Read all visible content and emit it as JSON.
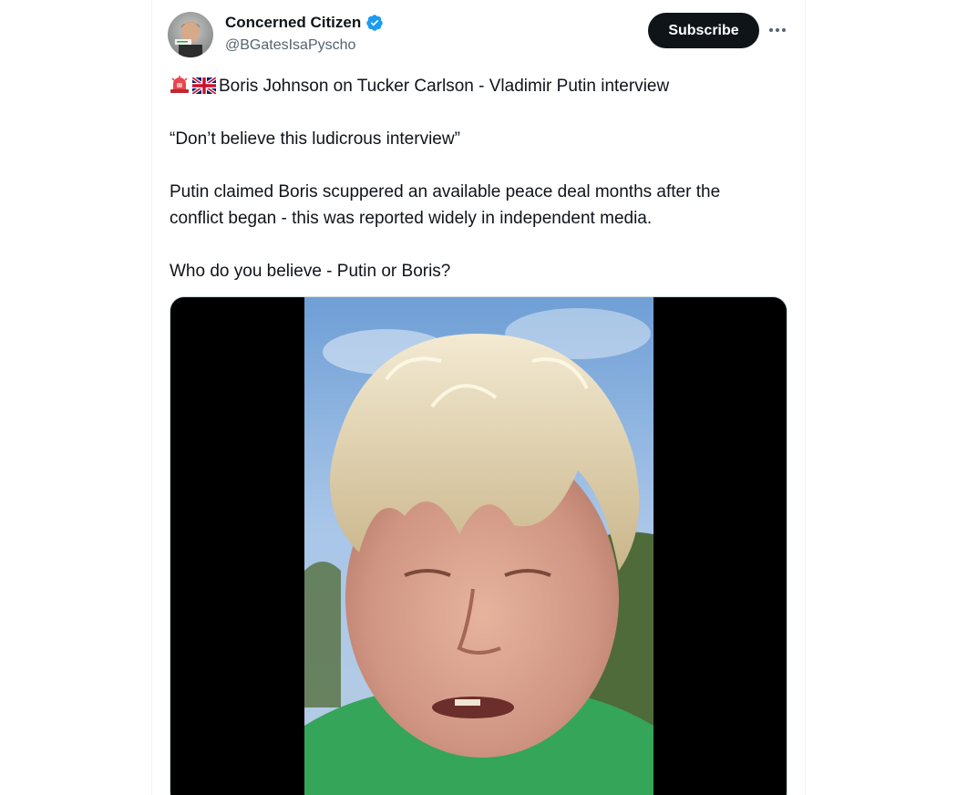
{
  "author": {
    "display_name": "Concerned Citizen",
    "handle": "@BGatesIsaPyscho",
    "verified": true,
    "avatar": "avatar-photo"
  },
  "actions": {
    "subscribe_label": "Subscribe",
    "more_icon": "more-horizontal-icon"
  },
  "tweet": {
    "line1": "Boris Johnson on Tucker Carlson - Vladimir Putin interview",
    "line1_emojis": [
      "siren-icon",
      "uk-flag-icon"
    ],
    "line2": "“Don’t believe this ludicrous interview”",
    "line3": "Putin claimed Boris scuppered an available peace deal months after the",
    "line4": "conflict began - this was reported widely in independent media.",
    "line5": "Who do you believe - Putin or Boris?"
  },
  "media": {
    "type": "video",
    "description_icon": "video-thumbnail"
  },
  "colors": {
    "primary_text": "#0f1419",
    "secondary_text": "#536471",
    "button_bg": "#0f1419",
    "verified_blue": "#1d9bf0"
  }
}
